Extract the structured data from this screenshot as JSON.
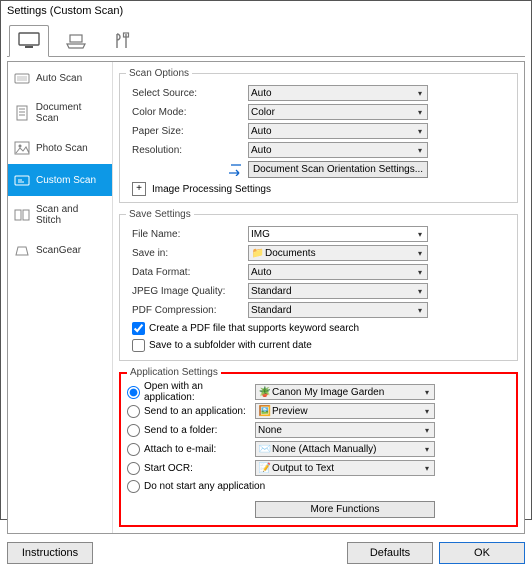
{
  "window_title": "Settings (Custom Scan)",
  "toolbar_tabs": [
    "monitor",
    "feeder",
    "tools"
  ],
  "sidebar": {
    "items": [
      {
        "label": "Auto Scan"
      },
      {
        "label": "Document Scan"
      },
      {
        "label": "Photo Scan"
      },
      {
        "label": "Custom Scan"
      },
      {
        "label": "Scan and Stitch"
      },
      {
        "label": "ScanGear"
      }
    ]
  },
  "groups": {
    "scan": {
      "legend": "Scan Options",
      "select_source": "Select Source:",
      "select_source_val": "Auto",
      "color_mode": "Color Mode:",
      "color_mode_val": "Color",
      "paper_size": "Paper Size:",
      "paper_size_val": "Auto",
      "resolution": "Resolution:",
      "resolution_val": "Auto",
      "orientation_btn": "Document Scan Orientation Settings...",
      "img_proc": "Image Processing Settings"
    },
    "save": {
      "legend": "Save Settings",
      "file_name": "File Name:",
      "file_name_val": "IMG",
      "save_in": "Save in:",
      "save_in_val": "Documents",
      "data_format": "Data Format:",
      "data_format_val": "Auto",
      "jpeg_q": "JPEG Image Quality:",
      "jpeg_q_val": "Standard",
      "pdf_comp": "PDF Compression:",
      "pdf_comp_val": "Standard",
      "cb1": "Create a PDF file that supports keyword search",
      "cb2": "Save to a subfolder with current date"
    },
    "app": {
      "legend": "Application Settings",
      "r1": "Open with an application:",
      "r1_val": "Canon My Image Garden",
      "r2": "Send to an application:",
      "r2_val": "Preview",
      "r3": "Send to a folder:",
      "r3_val": "None",
      "r4": "Attach to e-mail:",
      "r4_val": "None (Attach Manually)",
      "r5": "Start OCR:",
      "r5_val": "Output to Text",
      "r6": "Do not start any application",
      "more_btn": "More Functions"
    }
  },
  "footer": {
    "instructions": "Instructions",
    "defaults": "Defaults",
    "ok": "OK"
  }
}
